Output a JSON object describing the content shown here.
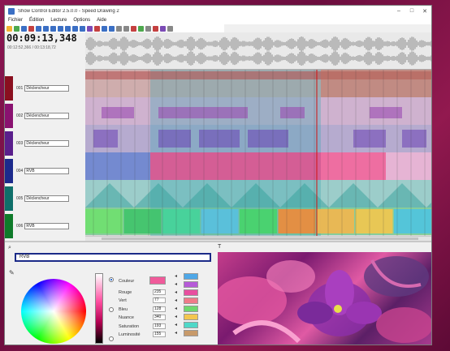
{
  "window": {
    "title": "Show Control Editor 2.5.0.0 - Speed Drawing 2",
    "controls": [
      "–",
      "□",
      "✕"
    ]
  },
  "menu": [
    "Fichier",
    "Édition",
    "Lecture",
    "Options",
    "Aide"
  ],
  "transport": {
    "timecode": "00:09:13,348",
    "subtime": "00:12:52,366 / 00:13:18,72"
  },
  "tracks": [
    {
      "num": "001",
      "name": "Déclencheur",
      "color": "#8a0f1f"
    },
    {
      "num": "002",
      "name": "Déclencheur",
      "color": "#8a1270"
    },
    {
      "num": "003",
      "name": "Déclencheur",
      "color": "#5a1f8c"
    },
    {
      "num": "004",
      "name": "RVB",
      "color": "#1c2a8c"
    },
    {
      "num": "005",
      "name": "Déclencheur",
      "color": "#0f6f6a"
    },
    {
      "num": "006",
      "name": "RVB",
      "color": "#0f7a2a"
    }
  ],
  "color_panel": {
    "search_value": "RVB",
    "properties": [
      {
        "label": "Couleur",
        "value": ""
      },
      {
        "label": "Rouge",
        "value": "235"
      },
      {
        "label": "Vert",
        "value": "77"
      },
      {
        "label": "Bleu",
        "value": "128"
      },
      {
        "label": "Nuance",
        "value": "340"
      },
      {
        "label": "Saturation",
        "value": "193"
      },
      {
        "label": "Luminosité",
        "value": "155"
      }
    ],
    "swatch_colors": [
      "#4fa8e8",
      "#b65bd8",
      "#e84fa0",
      "#f07a8a",
      "#6ed86e",
      "#f3c64e",
      "#4fd8c8",
      "#c89a6a"
    ]
  },
  "preview": {
    "label": "T"
  }
}
